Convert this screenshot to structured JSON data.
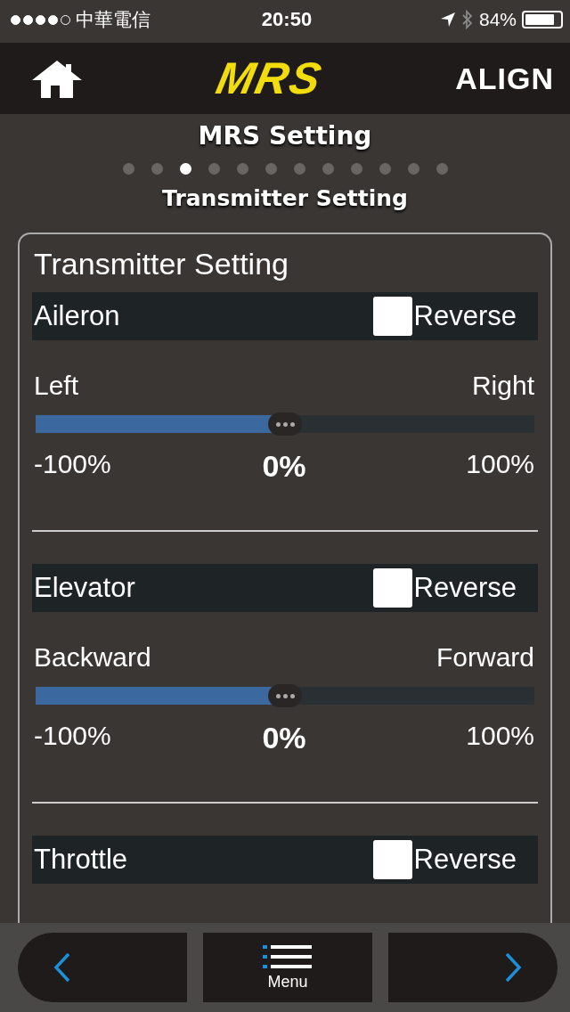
{
  "status_bar": {
    "signal_dots": [
      {
        "filled": true
      },
      {
        "filled": true
      },
      {
        "filled": true
      },
      {
        "filled": true
      },
      {
        "filled": false
      }
    ],
    "carrier": "中華電信",
    "time": "20:50",
    "battery": "84%"
  },
  "header": {
    "logo": "MRS",
    "brand": "ALIGN"
  },
  "title": "MRS Setting",
  "pages": [
    {
      "selected": false
    },
    {
      "selected": false
    },
    {
      "selected": true
    },
    {
      "selected": false
    },
    {
      "selected": false
    },
    {
      "selected": false
    },
    {
      "selected": false
    },
    {
      "selected": false
    },
    {
      "selected": false
    },
    {
      "selected": false
    },
    {
      "selected": false
    },
    {
      "selected": false
    }
  ],
  "subtitle": "Transmitter Setting",
  "card": {
    "title": "Transmitter Setting",
    "channels": [
      {
        "name": "Aileron",
        "reverse_label": "Reverse",
        "reverse": false,
        "left_label": "Left",
        "right_label": "Right",
        "level": 0.5,
        "min": "-100%",
        "value": "0%",
        "max": "100%"
      },
      {
        "name": "Elevator",
        "reverse_label": "Reverse",
        "reverse": false,
        "left_label": "Backward",
        "right_label": "Forward",
        "level": 0.5,
        "min": "-100%",
        "value": "0%",
        "max": "100%"
      },
      {
        "name": "Throttle",
        "reverse_label": "Reverse",
        "reverse": false
      }
    ]
  },
  "bottom_bar": {
    "menu": "Menu"
  }
}
